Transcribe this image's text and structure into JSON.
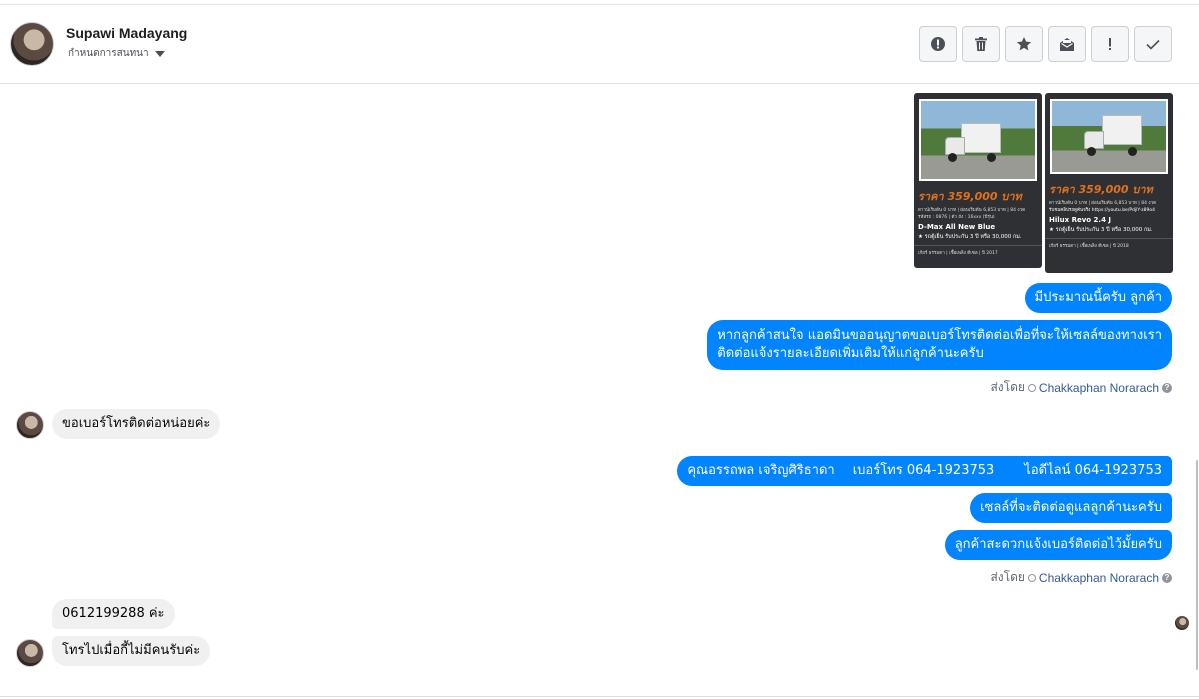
{
  "header": {
    "name": "Supawi Madayang",
    "subtitle": "กำหนดการสนทนา"
  },
  "actions": [
    {
      "icon": "alert-circle-icon"
    },
    {
      "icon": "trash-icon"
    },
    {
      "icon": "star-icon"
    },
    {
      "icon": "mark-unread-icon"
    },
    {
      "icon": "exclamation-icon"
    },
    {
      "icon": "checkmark-icon"
    }
  ],
  "cards": [
    {
      "price": "ราคา 359,000 บาท",
      "spec_line": "ดาวน์เริ่มต้น 0 บาท | ผ่อนเริ่มต้น 6,853 บาท | 84 งวด",
      "id_line": "รหัสรถ : 0876 | ตัว ถัง : 16xxx (ปีรุ่น)",
      "model": "D-Max All New Blue",
      "warranty": "★ รถตู้เย็น รับประกัน 3 ปี หรือ 30,000 กม.",
      "footer": "เกียร์ ธรรมดา | เชื้อเพลิง ดีเซล | ปี 2017"
    },
    {
      "price": "ราคา 359,000 บาท",
      "spec_line": "ดาวน์เริ่มต้น 0 บาท | ผ่อนเริ่มต้น 6,853 บาท | 84 งวด",
      "id_line": "รับชมคลิปรถดูคันจริง https://youtu.be/PdjlY-z89o4",
      "model": "Hilux Revo 2.4 J",
      "warranty": "★ รถตู้เย็น รับประกัน 3 ปี หรือ 30,000 กม.",
      "footer": "เกียร์ ธรรมดา | เชื้อเพลิง ดีเซล | ปี 2018"
    }
  ],
  "messages": {
    "out1": "มีประมาณนี้ครับ ลูกค้า",
    "out2_line1": "หากลูกค้าสนใจ แอดมินขออนุญาตขอเบอร์โทรติดต่อเพื่อที่จะให้เซลล์ของทางเรา",
    "out2_line2": "ติดต่อแจ้งรายละเอียดเพิ่มเติมให้แก่ลูกค้านะครับ",
    "sent_by_label": "ส่งโดย",
    "agent": "Chakkaphan Norarach",
    "in1": "ขอเบอร์โทรติดต่อหน่อยค่ะ",
    "out3_name": "คุณอรรถพล เจริญศิริธาดา",
    "out3_phone": "เบอร์โทร 064-1923753",
    "out3_line": "ไอดีไลน์ 064-1923753",
    "out4": "เซลล์ที่จะติดต่อดูแลลูกค้านะครับ",
    "out5": "ลูกค้าสะดวกแจ้งเบอร์ติดต่อไว้มั้ยครับ",
    "in2": "0612199288 ค่ะ",
    "in3": "โทรไปเมื่อกี้ไม่มีคนรับค่ะ"
  }
}
